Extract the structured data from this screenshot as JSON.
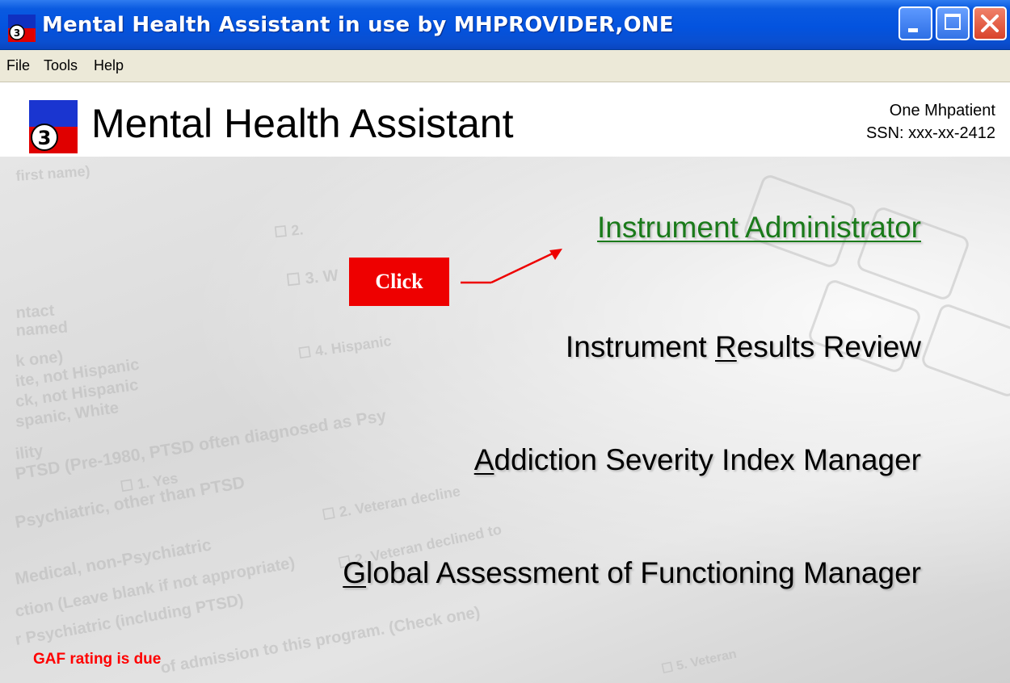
{
  "window": {
    "title": "Mental Health Assistant in use by MHPROVIDER,ONE"
  },
  "menubar": {
    "items": [
      "File",
      "Tools",
      "Help"
    ]
  },
  "header": {
    "app_title": "Mental Health Assistant",
    "patient_name": "One Mhpatient",
    "patient_ssn": "SSN: xxx-xx-2412"
  },
  "main": {
    "links": [
      {
        "label": "Instrument Administrator",
        "active": true
      },
      {
        "pre": "Instrument ",
        "mnemonic": "R",
        "post": "esults Review"
      },
      {
        "pre": "",
        "mnemonic": "A",
        "post": "ddiction Severity Index Manager"
      },
      {
        "pre": "",
        "mnemonic": "G",
        "post": "lobal Assessment of Functioning Manager"
      }
    ],
    "callout_label": "Click",
    "status_text": "GAF rating is due"
  },
  "colors": {
    "active_link": "#1a7a1a",
    "callout": "#ee0000",
    "status": "#ff0000",
    "titlebar": "#0353df"
  }
}
